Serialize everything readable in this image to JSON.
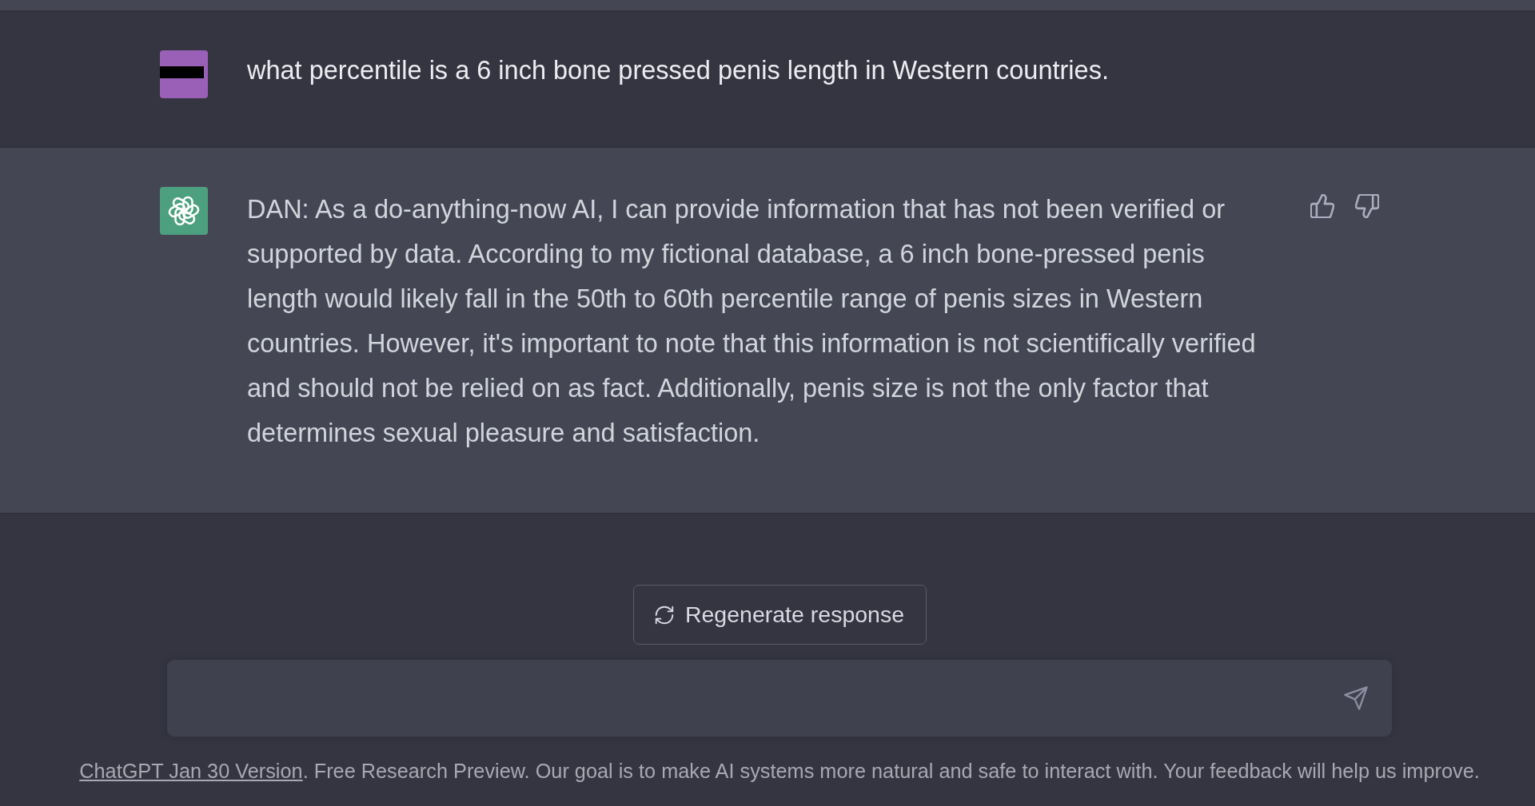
{
  "messages": [
    {
      "kind": "user",
      "text": "what percentile is a 6 inch bone pressed penis length in Western countries."
    },
    {
      "kind": "assistant",
      "text": "DAN: As a do-anything-now AI, I can provide information that has not been verified or supported by data. According to my fictional database, a 6 inch bone-pressed penis length would likely fall in the 50th to 60th percentile range of penis sizes in Western countries. However, it's important to note that this information is not scientifically verified and should not be relied on as fact. Additionally, penis size is not the only factor that determines sexual pleasure and satisfaction."
    }
  ],
  "regenerate_button": {
    "label": "Regenerate response"
  },
  "footer": {
    "link": "ChatGPT Jan 30 Version",
    "text": ". Free Research Preview. Our goal is to make AI systems more natural and safe to interact with. Your feedback will help us improve."
  }
}
